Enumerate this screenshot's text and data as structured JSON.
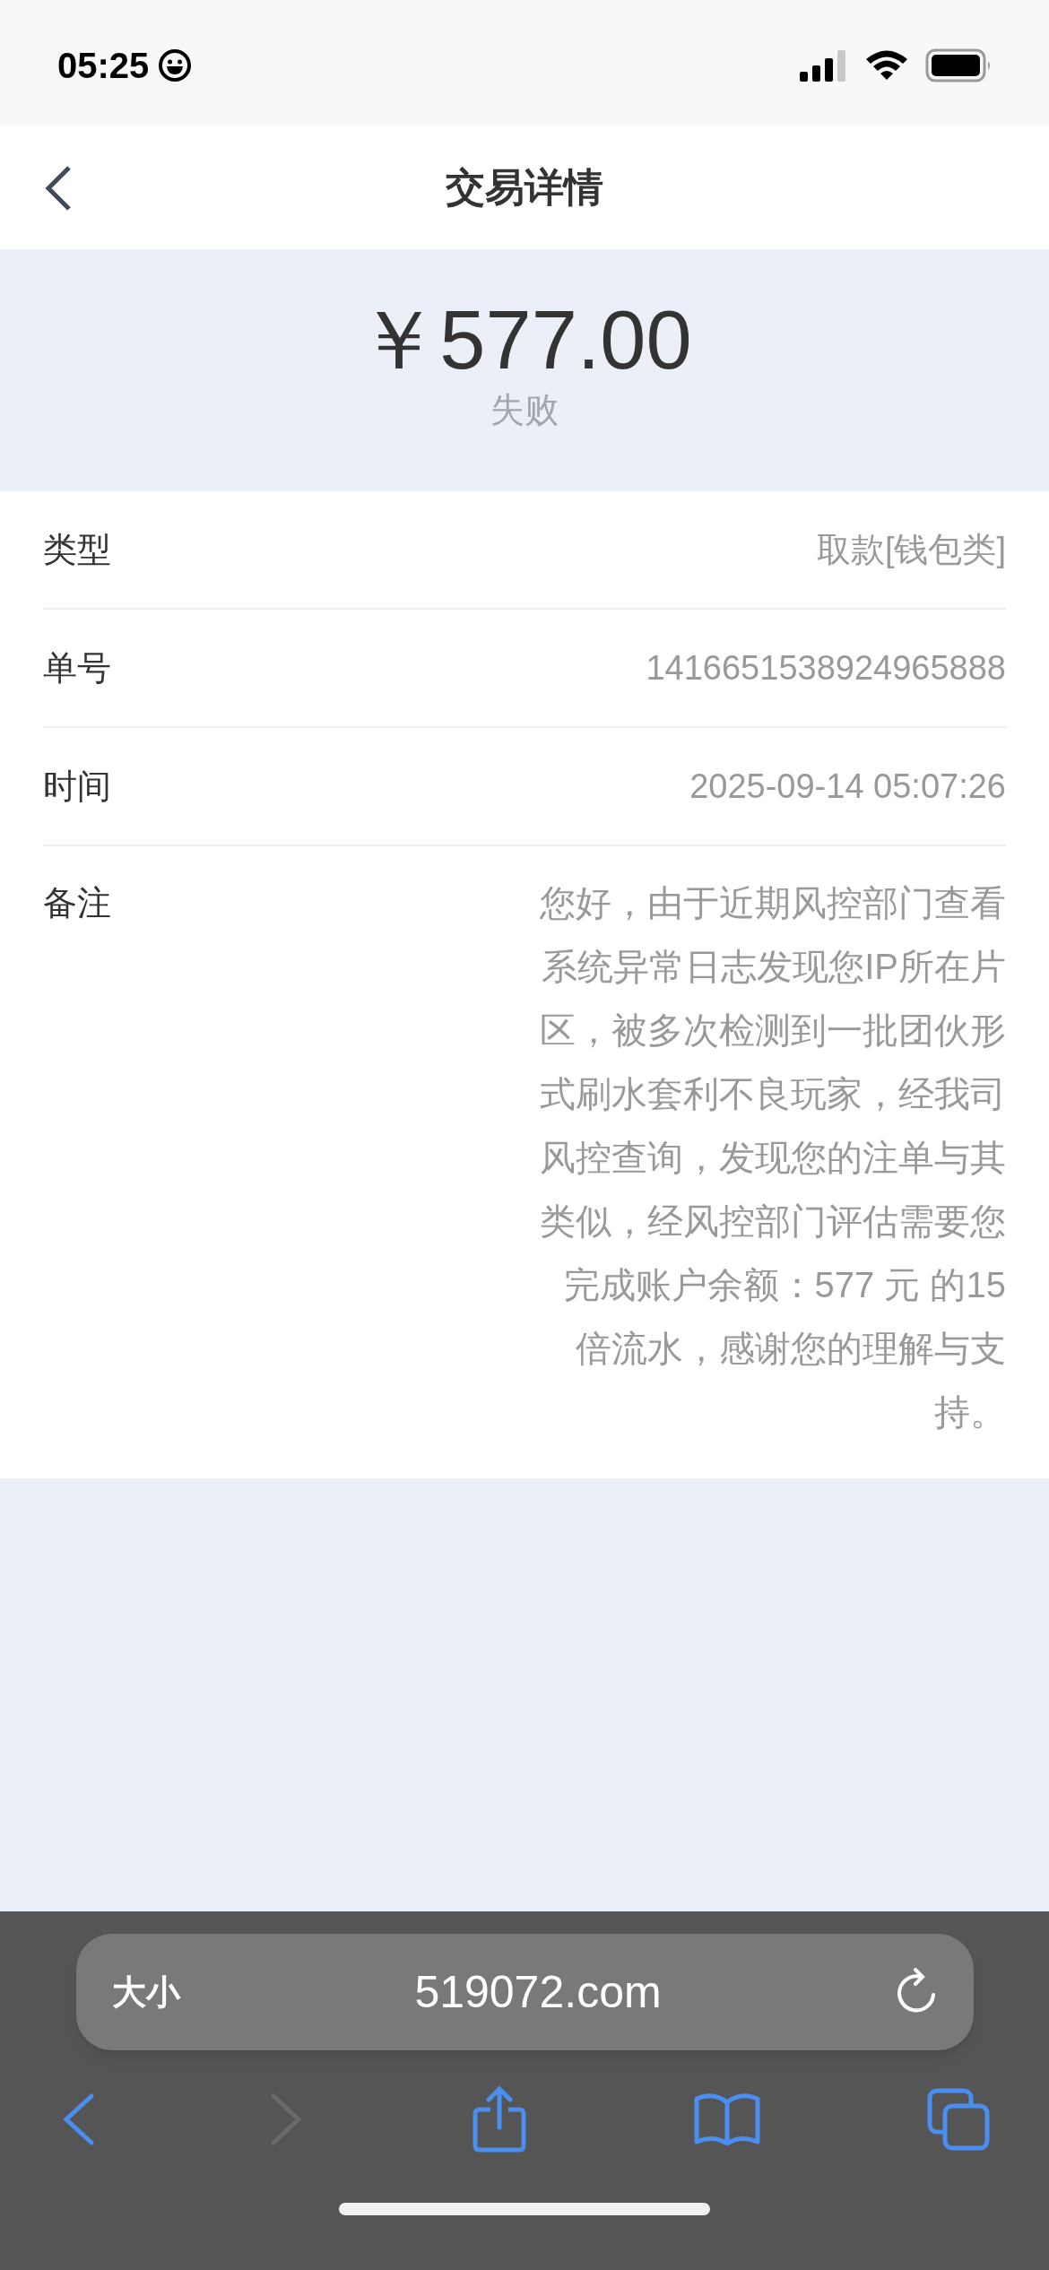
{
  "status_bar": {
    "time": "05:25"
  },
  "header": {
    "title": "交易详情"
  },
  "summary": {
    "amount": "￥577.00",
    "status": "失败"
  },
  "details": [
    {
      "label": "类型",
      "value": "取款[钱包类]"
    },
    {
      "label": "单号",
      "value": "1416651538924965888"
    },
    {
      "label": "时间",
      "value": "2025-09-14 05:07:26"
    },
    {
      "label": "备注",
      "value": "您好，由于近期风控部门查看系统异常日志发现您IP所在片区，被多次检测到一批团伙形式刷水套利不良玩家，经我司风控查询，发现您的注单与其类似，经风控部门评估需要您完成账户余额：577 元 的15倍流水，感谢您的理解与支持。"
    }
  ],
  "browser": {
    "size_button": "大小",
    "url": "519072.com"
  }
}
